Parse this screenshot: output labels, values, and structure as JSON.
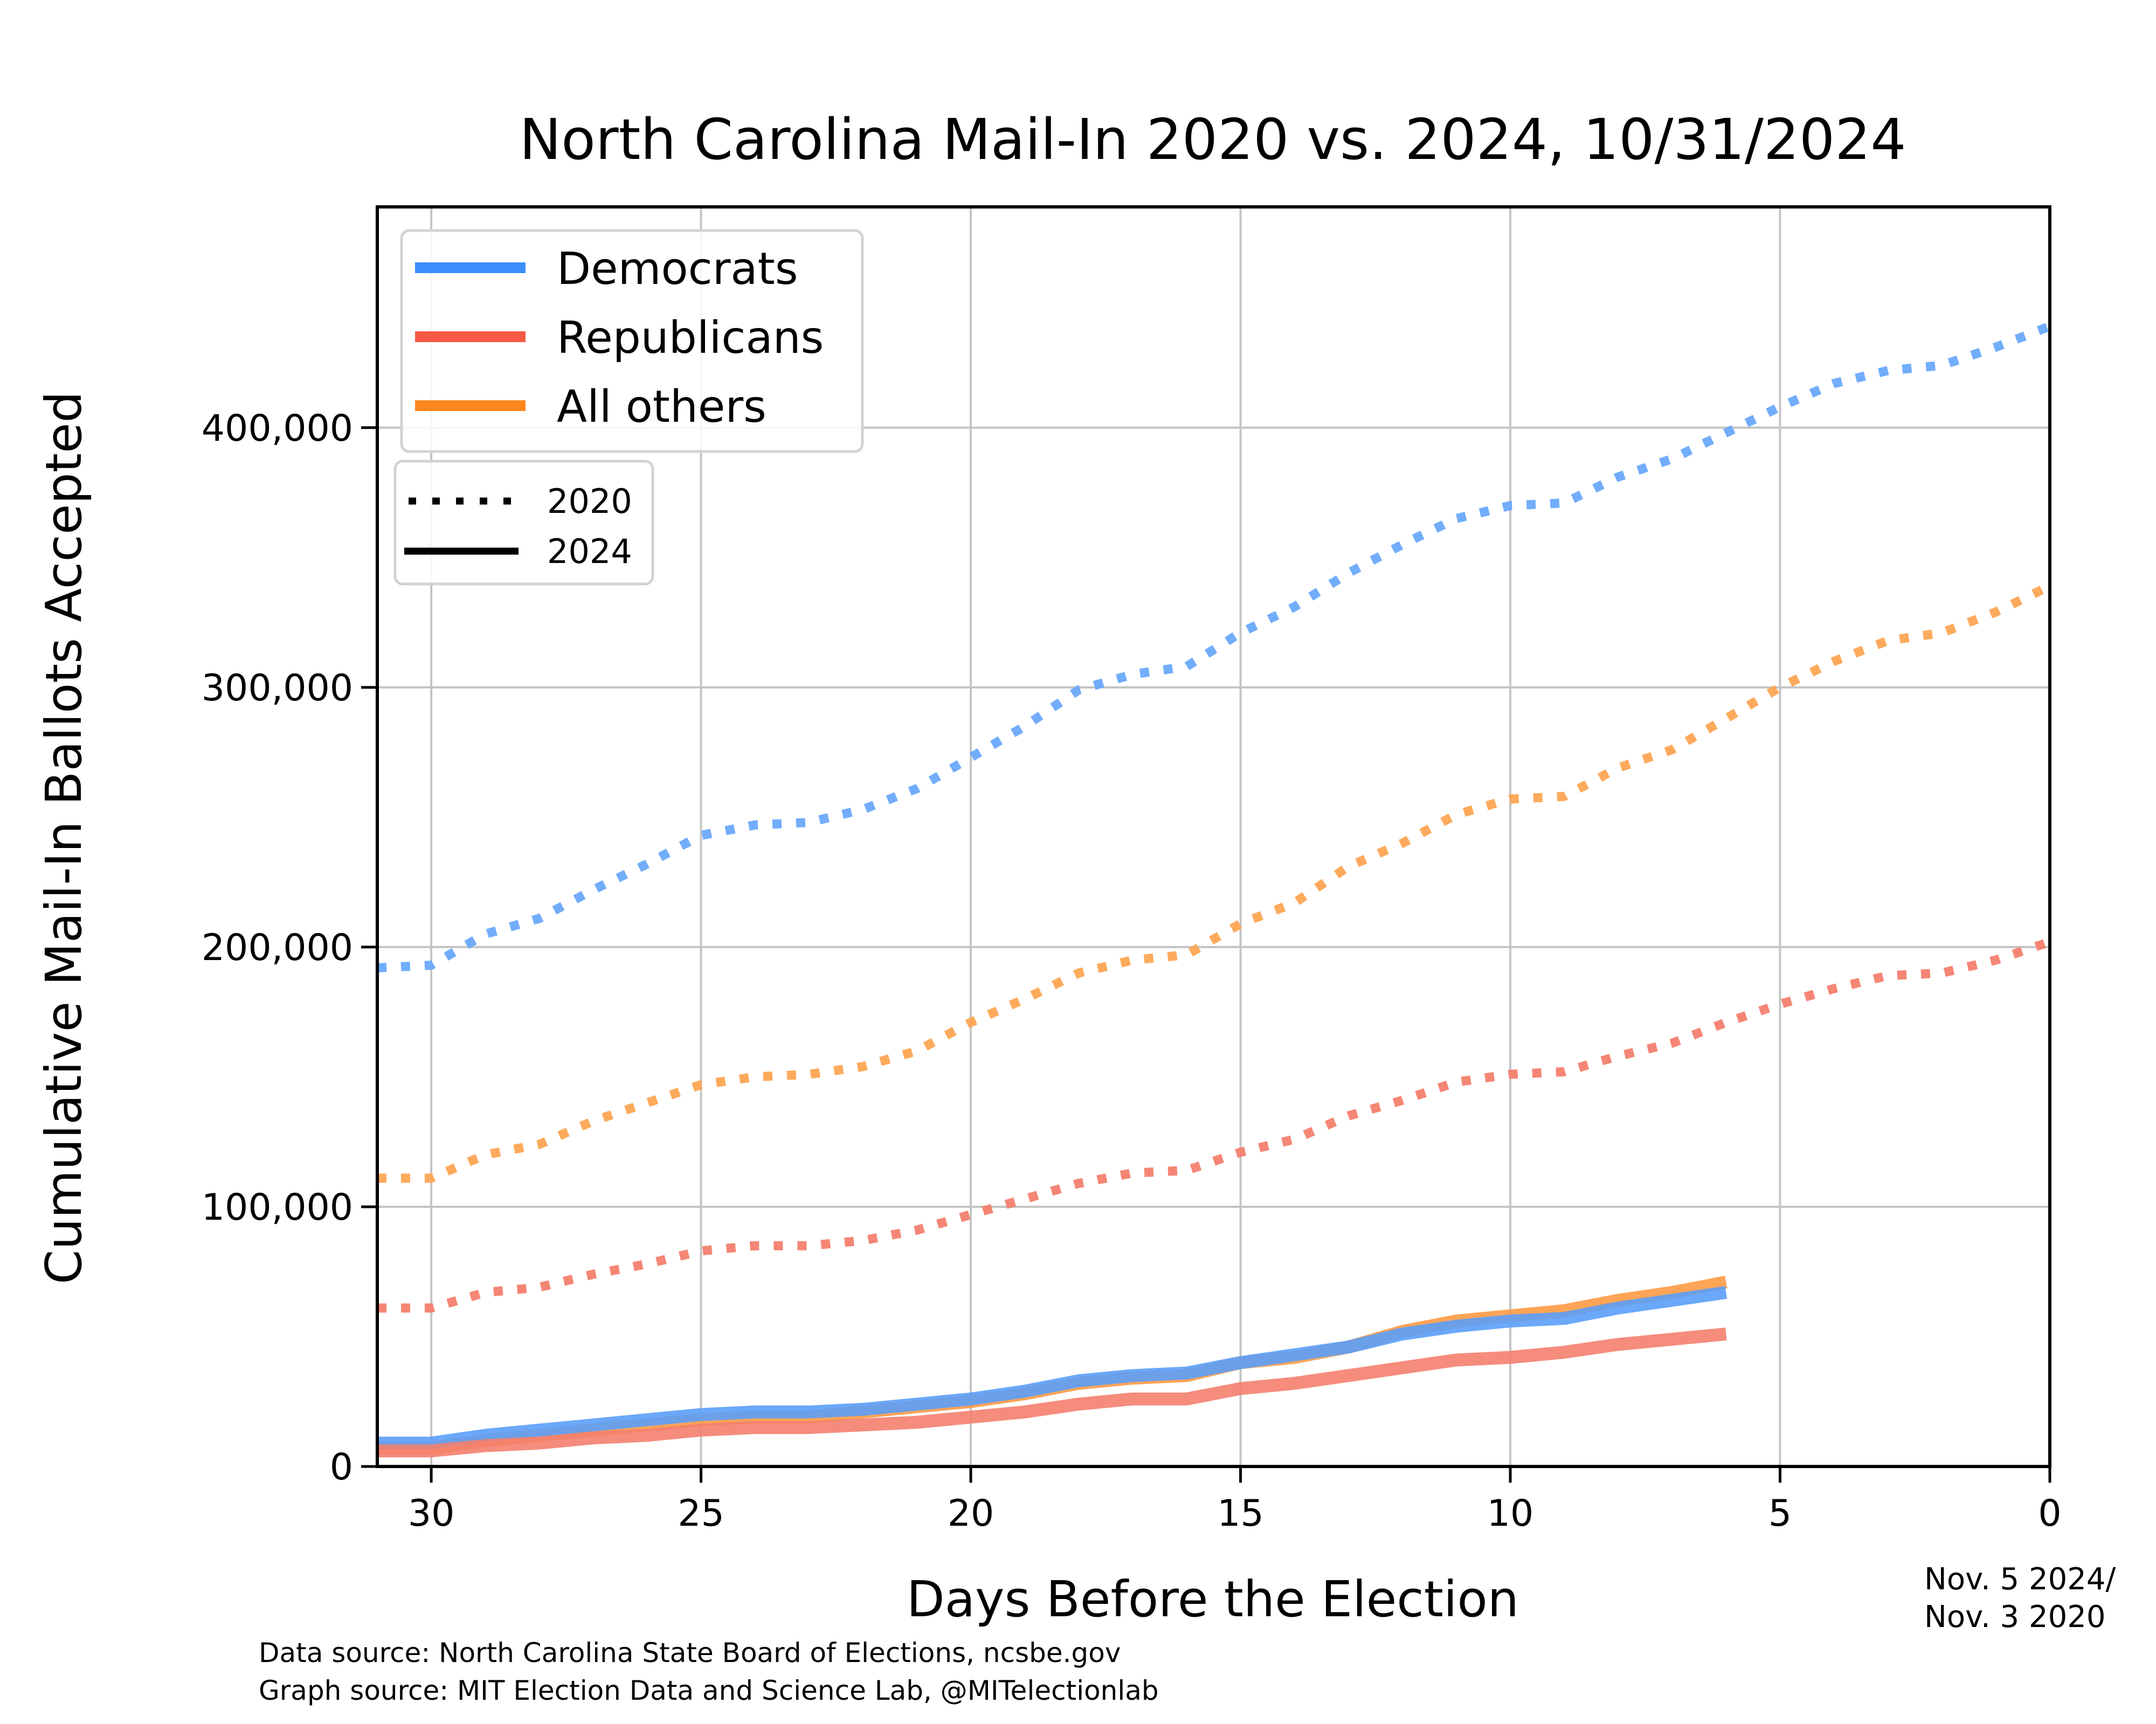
{
  "chart_data": {
    "type": "line",
    "title": "North Carolina Mail-In 2020 vs. 2024, 10/31/2024",
    "xlabel": "Days Before the Election",
    "ylabel": "Cumulative Mail-In Ballots Accepted",
    "xlim": [
      31,
      0
    ],
    "ylim": [
      0,
      485000
    ],
    "x_reversed": true,
    "grid": true,
    "x_ticks": [
      30,
      25,
      20,
      15,
      10,
      5,
      0
    ],
    "x_tick_labels": [
      "30",
      "25",
      "20",
      "15",
      "10",
      "5",
      "0"
    ],
    "y_ticks": [
      0,
      100000,
      200000,
      300000,
      400000
    ],
    "y_tick_labels": [
      "0",
      "100,000",
      "200,000",
      "300,000",
      "400,000"
    ],
    "election_date_note": [
      "Nov. 5 2024/",
      "Nov. 3 2020"
    ],
    "legend_party": {
      "placement": "top-left",
      "entries": [
        {
          "label": "Democrats",
          "color": "#3a8ffc"
        },
        {
          "label": "Republicans",
          "color": "#f65a45"
        },
        {
          "label": "All others",
          "color": "#fd861f"
        }
      ]
    },
    "legend_year": {
      "placement": "top-left",
      "entries": [
        {
          "label": "2020",
          "style": "dotted"
        },
        {
          "label": "2024",
          "style": "solid"
        }
      ]
    },
    "x_2020": [
      31,
      30,
      29,
      28,
      27,
      26,
      25,
      24,
      23,
      22,
      21,
      20,
      19,
      18,
      17,
      16,
      15,
      14,
      13,
      12,
      11,
      10,
      9,
      8,
      7,
      6,
      5,
      4,
      3,
      2,
      1,
      0
    ],
    "x_2024": [
      31,
      30,
      29,
      28,
      27,
      26,
      25,
      24,
      23,
      22,
      21,
      20,
      19,
      18,
      17,
      16,
      15,
      14,
      13,
      12,
      11,
      10,
      9,
      8,
      7,
      6
    ],
    "series": [
      {
        "name": "Democrats 2020",
        "party": "Democrats",
        "year": "2020",
        "style": "dotted",
        "color": "#6aa9fb",
        "values": [
          192000,
          193000,
          205000,
          211000,
          222000,
          232000,
          243000,
          247000,
          248000,
          253000,
          261000,
          273000,
          285000,
          299000,
          305000,
          308000,
          321000,
          331000,
          344000,
          355000,
          365000,
          370000,
          371000,
          381000,
          388000,
          398000,
          408000,
          417000,
          422000,
          424000,
          431000,
          439000
        ]
      },
      {
        "name": "All others 2020",
        "party": "All others",
        "year": "2020",
        "style": "dotted",
        "color": "#fda553",
        "values": [
          111000,
          111000,
          120000,
          124000,
          133000,
          140000,
          147000,
          150000,
          151000,
          154000,
          160000,
          171000,
          180000,
          190000,
          195000,
          197000,
          209000,
          217000,
          231000,
          240000,
          251000,
          257000,
          258000,
          269000,
          276000,
          288000,
          300000,
          310000,
          318000,
          321000,
          329000,
          339000
        ]
      },
      {
        "name": "Republicans 2020",
        "party": "Republicans",
        "year": "2020",
        "style": "dotted",
        "color": "#f4806e",
        "values": [
          61000,
          61000,
          67000,
          69000,
          74000,
          78000,
          83000,
          85000,
          85000,
          87000,
          91000,
          97000,
          103000,
          109000,
          113000,
          114000,
          121000,
          126000,
          135000,
          141000,
          148000,
          151000,
          152000,
          158000,
          163000,
          171000,
          178000,
          184000,
          189000,
          190000,
          195000,
          202000
        ]
      },
      {
        "name": "All others 2024",
        "party": "All others",
        "year": "2024",
        "style": "solid",
        "color": "#fd9a45",
        "values": [
          7000,
          7000,
          10000,
          12000,
          14000,
          16000,
          18000,
          19000,
          19000,
          21000,
          23000,
          25000,
          28000,
          32000,
          34000,
          35000,
          40000,
          42000,
          46000,
          52000,
          56000,
          58000,
          60000,
          64000,
          67000,
          71000
        ]
      },
      {
        "name": "Democrats 2024",
        "party": "Democrats",
        "year": "2024",
        "style": "solid",
        "color": "#5b9ef8",
        "values": [
          9000,
          9000,
          12000,
          14000,
          16000,
          18000,
          20000,
          21000,
          21000,
          22000,
          24000,
          26000,
          29000,
          33000,
          35000,
          36000,
          40000,
          43000,
          46000,
          51000,
          54000,
          56000,
          57000,
          61000,
          64000,
          67000
        ]
      },
      {
        "name": "Republicans 2024",
        "party": "Republicans",
        "year": "2024",
        "style": "solid",
        "color": "#f4806e",
        "values": [
          6000,
          6000,
          8000,
          9000,
          11000,
          12000,
          14000,
          15000,
          15000,
          16000,
          17000,
          19000,
          21000,
          24000,
          26000,
          26000,
          30000,
          32000,
          35000,
          38000,
          41000,
          42000,
          44000,
          47000,
          49000,
          51000
        ]
      }
    ]
  },
  "footer": {
    "data_source": "Data source: North Carolina State Board of Elections, ncsbe.gov",
    "graph_source": "Graph source: MIT Election Data and Science Lab, @MITelectionlab"
  }
}
